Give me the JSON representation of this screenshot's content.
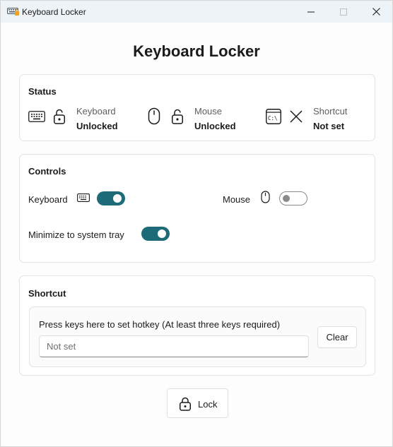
{
  "window": {
    "title": "Keyboard Locker",
    "controls": {
      "minimize": "minimize-icon",
      "maximize": "maximize-icon",
      "close": "close-icon"
    }
  },
  "page": {
    "heading": "Keyboard Locker"
  },
  "status": {
    "title": "Status",
    "items": [
      {
        "label": "Keyboard",
        "value": "Unlocked",
        "device_icon": "keyboard-icon",
        "state_icon": "unlock-icon"
      },
      {
        "label": "Mouse",
        "value": "Unlocked",
        "device_icon": "mouse-icon",
        "state_icon": "unlock-icon"
      },
      {
        "label": "Shortcut",
        "value": "Not set",
        "device_icon": "terminal-icon",
        "state_icon": "x-icon"
      }
    ]
  },
  "controls": {
    "title": "Controls",
    "keyboard": {
      "label": "Keyboard",
      "icon": "keyboard-icon",
      "enabled": true
    },
    "mouse": {
      "label": "Mouse",
      "icon": "mouse-icon",
      "enabled": false
    },
    "tray": {
      "label": "Minimize to system tray",
      "enabled": true
    }
  },
  "shortcut": {
    "title": "Shortcut",
    "instruction": "Press keys here to set hotkey (At least three keys required)",
    "input_value": "",
    "input_placeholder": "Not set",
    "clear_label": "Clear"
  },
  "lock_button": {
    "label": "Lock",
    "icon": "lock-icon"
  },
  "colors": {
    "accent": "#1d6b78",
    "titlebar": "#eef3f8",
    "card_border": "#e3e3e3",
    "text": "#1b1b1b",
    "muted_text": "#5f5f5f"
  }
}
